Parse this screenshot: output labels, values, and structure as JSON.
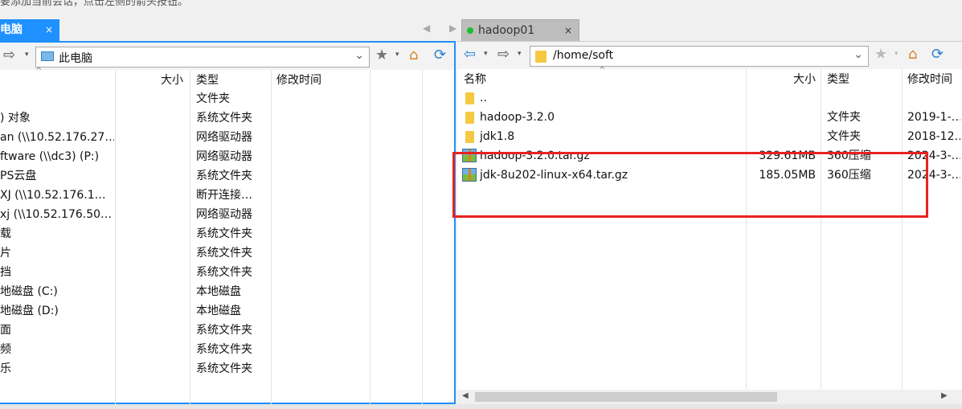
{
  "hint_text": "要添加当前会话，点击左侧的箭头按钮。",
  "tabs": {
    "left": {
      "label": "电脑",
      "close": "×"
    },
    "right": {
      "label": "hadoop01",
      "close": "×"
    },
    "nav": "◀ ▶"
  },
  "icons": {
    "back": "⇦",
    "forward": "⇨",
    "caret": "▾",
    "star": "★",
    "home": "⌂",
    "refresh": "⟳",
    "dropdown": "⌄"
  },
  "left_pane": {
    "address": "此电脑",
    "columns": {
      "size": "大小",
      "type": "类型",
      "modified": "修改时间"
    },
    "rows": [
      {
        "name": "",
        "type": "文件夹"
      },
      {
        "name": ") 对象",
        "type": "系统文件夹"
      },
      {
        "name": "an (\\\\10.52.176.27…",
        "type": "网络驱动器"
      },
      {
        "name": "ftware (\\\\dc3) (P:)",
        "type": "网络驱动器"
      },
      {
        "name": "PS云盘",
        "type": "系统文件夹"
      },
      {
        "name": "XJ (\\\\10.52.176.1…",
        "type": "断开连接…"
      },
      {
        "name": "xj (\\\\10.52.176.50…",
        "type": "网络驱动器"
      },
      {
        "name": "载",
        "type": "系统文件夹"
      },
      {
        "name": "片",
        "type": "系统文件夹"
      },
      {
        "name": "挡",
        "type": "系统文件夹"
      },
      {
        "name": "地磁盘 (C:)",
        "type": "本地磁盘"
      },
      {
        "name": "地磁盘 (D:)",
        "type": "本地磁盘"
      },
      {
        "name": "面",
        "type": "系统文件夹"
      },
      {
        "name": "频",
        "type": "系统文件夹"
      },
      {
        "name": "乐",
        "type": "系统文件夹"
      }
    ]
  },
  "right_pane": {
    "address": "/home/soft",
    "columns": {
      "name": "名称",
      "size": "大小",
      "type": "类型",
      "modified": "修改时间"
    },
    "rows": [
      {
        "icon": "folder",
        "name": "..",
        "size": "",
        "type": "",
        "modified": ""
      },
      {
        "icon": "folder",
        "name": "hadoop-3.2.0",
        "size": "",
        "type": "文件夹",
        "modified": "2019-1-…"
      },
      {
        "icon": "folder",
        "name": "jdk1.8",
        "size": "",
        "type": "文件夹",
        "modified": "2018-12…"
      },
      {
        "icon": "archive",
        "name": "hadoop-3.2.0.tar.gz",
        "size": "329.61MB",
        "type": "360压缩",
        "modified": "2024-3-…"
      },
      {
        "icon": "archive",
        "name": "jdk-8u202-linux-x64.tar.gz",
        "size": "185.05MB",
        "type": "360压缩",
        "modified": "2024-3-…"
      }
    ]
  },
  "scroll": {
    "left_arrow": "◀",
    "right_arrow": "▶"
  },
  "colors": {
    "accent": "#1e90ff",
    "highlight": "#e8231f",
    "status_dot": "#1bbf2b"
  }
}
